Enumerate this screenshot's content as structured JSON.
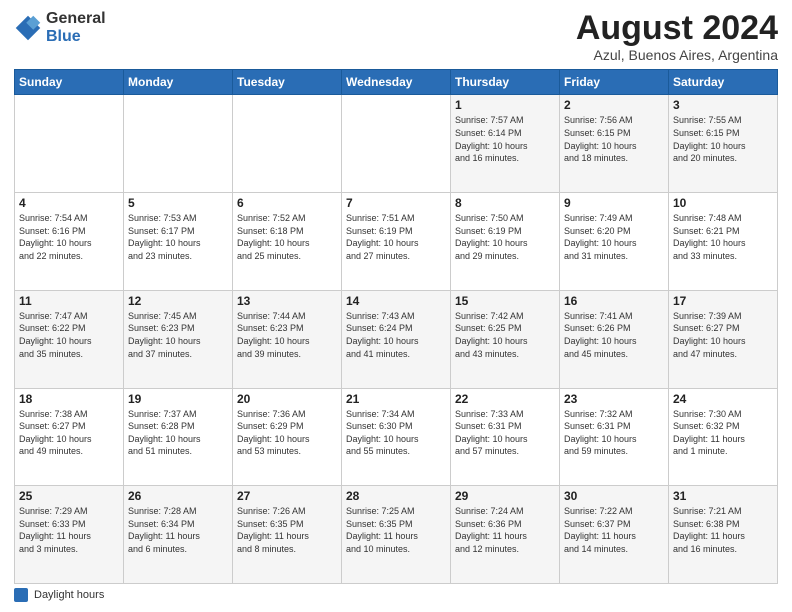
{
  "logo": {
    "general": "General",
    "blue": "Blue"
  },
  "title": "August 2024",
  "subtitle": "Azul, Buenos Aires, Argentina",
  "days_header": [
    "Sunday",
    "Monday",
    "Tuesday",
    "Wednesday",
    "Thursday",
    "Friday",
    "Saturday"
  ],
  "legend_label": "Daylight hours",
  "weeks": [
    [
      {
        "day": "",
        "info": ""
      },
      {
        "day": "",
        "info": ""
      },
      {
        "day": "",
        "info": ""
      },
      {
        "day": "",
        "info": ""
      },
      {
        "day": "1",
        "info": "Sunrise: 7:57 AM\nSunset: 6:14 PM\nDaylight: 10 hours\nand 16 minutes."
      },
      {
        "day": "2",
        "info": "Sunrise: 7:56 AM\nSunset: 6:15 PM\nDaylight: 10 hours\nand 18 minutes."
      },
      {
        "day": "3",
        "info": "Sunrise: 7:55 AM\nSunset: 6:15 PM\nDaylight: 10 hours\nand 20 minutes."
      }
    ],
    [
      {
        "day": "4",
        "info": "Sunrise: 7:54 AM\nSunset: 6:16 PM\nDaylight: 10 hours\nand 22 minutes."
      },
      {
        "day": "5",
        "info": "Sunrise: 7:53 AM\nSunset: 6:17 PM\nDaylight: 10 hours\nand 23 minutes."
      },
      {
        "day": "6",
        "info": "Sunrise: 7:52 AM\nSunset: 6:18 PM\nDaylight: 10 hours\nand 25 minutes."
      },
      {
        "day": "7",
        "info": "Sunrise: 7:51 AM\nSunset: 6:19 PM\nDaylight: 10 hours\nand 27 minutes."
      },
      {
        "day": "8",
        "info": "Sunrise: 7:50 AM\nSunset: 6:19 PM\nDaylight: 10 hours\nand 29 minutes."
      },
      {
        "day": "9",
        "info": "Sunrise: 7:49 AM\nSunset: 6:20 PM\nDaylight: 10 hours\nand 31 minutes."
      },
      {
        "day": "10",
        "info": "Sunrise: 7:48 AM\nSunset: 6:21 PM\nDaylight: 10 hours\nand 33 minutes."
      }
    ],
    [
      {
        "day": "11",
        "info": "Sunrise: 7:47 AM\nSunset: 6:22 PM\nDaylight: 10 hours\nand 35 minutes."
      },
      {
        "day": "12",
        "info": "Sunrise: 7:45 AM\nSunset: 6:23 PM\nDaylight: 10 hours\nand 37 minutes."
      },
      {
        "day": "13",
        "info": "Sunrise: 7:44 AM\nSunset: 6:23 PM\nDaylight: 10 hours\nand 39 minutes."
      },
      {
        "day": "14",
        "info": "Sunrise: 7:43 AM\nSunset: 6:24 PM\nDaylight: 10 hours\nand 41 minutes."
      },
      {
        "day": "15",
        "info": "Sunrise: 7:42 AM\nSunset: 6:25 PM\nDaylight: 10 hours\nand 43 minutes."
      },
      {
        "day": "16",
        "info": "Sunrise: 7:41 AM\nSunset: 6:26 PM\nDaylight: 10 hours\nand 45 minutes."
      },
      {
        "day": "17",
        "info": "Sunrise: 7:39 AM\nSunset: 6:27 PM\nDaylight: 10 hours\nand 47 minutes."
      }
    ],
    [
      {
        "day": "18",
        "info": "Sunrise: 7:38 AM\nSunset: 6:27 PM\nDaylight: 10 hours\nand 49 minutes."
      },
      {
        "day": "19",
        "info": "Sunrise: 7:37 AM\nSunset: 6:28 PM\nDaylight: 10 hours\nand 51 minutes."
      },
      {
        "day": "20",
        "info": "Sunrise: 7:36 AM\nSunset: 6:29 PM\nDaylight: 10 hours\nand 53 minutes."
      },
      {
        "day": "21",
        "info": "Sunrise: 7:34 AM\nSunset: 6:30 PM\nDaylight: 10 hours\nand 55 minutes."
      },
      {
        "day": "22",
        "info": "Sunrise: 7:33 AM\nSunset: 6:31 PM\nDaylight: 10 hours\nand 57 minutes."
      },
      {
        "day": "23",
        "info": "Sunrise: 7:32 AM\nSunset: 6:31 PM\nDaylight: 10 hours\nand 59 minutes."
      },
      {
        "day": "24",
        "info": "Sunrise: 7:30 AM\nSunset: 6:32 PM\nDaylight: 11 hours\nand 1 minute."
      }
    ],
    [
      {
        "day": "25",
        "info": "Sunrise: 7:29 AM\nSunset: 6:33 PM\nDaylight: 11 hours\nand 3 minutes."
      },
      {
        "day": "26",
        "info": "Sunrise: 7:28 AM\nSunset: 6:34 PM\nDaylight: 11 hours\nand 6 minutes."
      },
      {
        "day": "27",
        "info": "Sunrise: 7:26 AM\nSunset: 6:35 PM\nDaylight: 11 hours\nand 8 minutes."
      },
      {
        "day": "28",
        "info": "Sunrise: 7:25 AM\nSunset: 6:35 PM\nDaylight: 11 hours\nand 10 minutes."
      },
      {
        "day": "29",
        "info": "Sunrise: 7:24 AM\nSunset: 6:36 PM\nDaylight: 11 hours\nand 12 minutes."
      },
      {
        "day": "30",
        "info": "Sunrise: 7:22 AM\nSunset: 6:37 PM\nDaylight: 11 hours\nand 14 minutes."
      },
      {
        "day": "31",
        "info": "Sunrise: 7:21 AM\nSunset: 6:38 PM\nDaylight: 11 hours\nand 16 minutes."
      }
    ]
  ]
}
